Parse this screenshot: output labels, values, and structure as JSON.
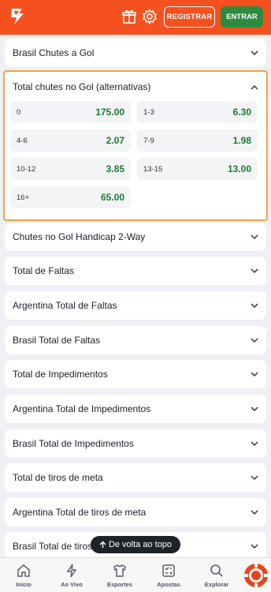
{
  "header": {
    "register_label": "REGISTRAR",
    "login_label": "ENTRAR",
    "brand_color": "#f4511e",
    "login_color": "#2e8b3e"
  },
  "markets_top": [
    {
      "label": "Brasil Chutes a Gol"
    }
  ],
  "open_market": {
    "title": "Total chutes no Gol (alternativas)",
    "odds": [
      {
        "label": "0",
        "value": "175.00"
      },
      {
        "label": "1-3",
        "value": "6.30"
      },
      {
        "label": "4-6",
        "value": "2.07"
      },
      {
        "label": "7-9",
        "value": "1.98"
      },
      {
        "label": "10-12",
        "value": "3.85"
      },
      {
        "label": "13-15",
        "value": "13.00"
      },
      {
        "label": "16+",
        "value": "65.00"
      }
    ],
    "highlight_color": "#f1a34a"
  },
  "markets": [
    {
      "label": "Chutes no Gol Handicap 2-Way"
    },
    {
      "label": "Total de Faltas"
    },
    {
      "label": "Argentina Total de Faltas"
    },
    {
      "label": "Brasil Total de Faltas"
    },
    {
      "label": "Total de Impedimentos"
    },
    {
      "label": "Argentina Total de Impedimentos"
    },
    {
      "label": "Brasil Total de Impedimentos"
    },
    {
      "label": "Total de tiros de meta"
    },
    {
      "label": "Argentina Total de tiros de meta"
    },
    {
      "label": "Brasil Total de tiros de meta"
    }
  ],
  "back_to_top": {
    "label": "De volta ao topo"
  },
  "bottom_nav": [
    {
      "label": "Início",
      "icon": "home-icon"
    },
    {
      "label": "Ao Vivo",
      "icon": "lightning-icon"
    },
    {
      "label": "Esportes",
      "icon": "shirt-icon"
    },
    {
      "label": "Apostas",
      "icon": "betslip-icon"
    },
    {
      "label": "Explorar",
      "icon": "search-icon"
    }
  ]
}
